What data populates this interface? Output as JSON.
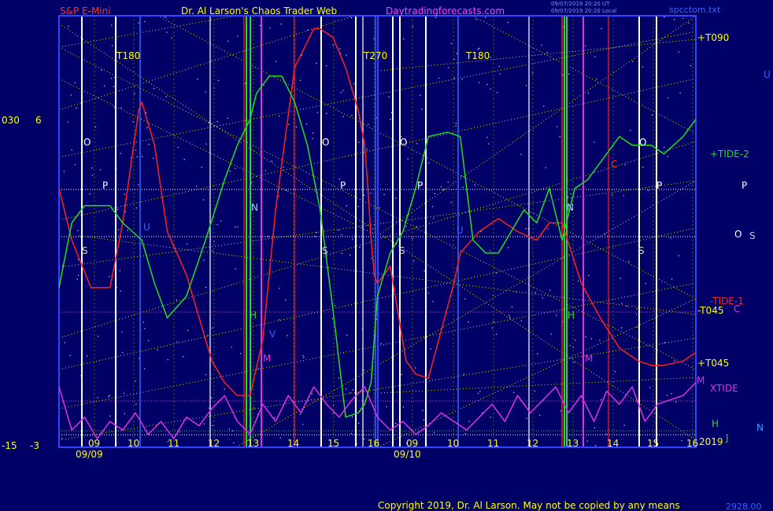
{
  "header": {
    "symbol": "S&P E-Mini",
    "title": "Dr. Al Larson's Chaos Trader Web",
    "site": "Daytradingforecasts.com",
    "stamp1": "09/07/2019 20:20 UT",
    "stamp2": "09/07/2019 20:20 Local",
    "file": "spcctom.txt"
  },
  "left_scale": {
    "top_a": "030",
    "top_b": "6",
    "bottom_a": "-15",
    "bottom_b": "-3"
  },
  "footer": {
    "copyright": "Copyright 2019, Dr. Al Larson. May not be copied by any means",
    "price": "2928.00"
  },
  "colors": {
    "bg": "#000066",
    "frame": "#3344ff",
    "red": "#ff2020",
    "green": "#20e020",
    "magenta": "#e030e0",
    "yellow": "#e8e800",
    "white": "#ffffff",
    "blue": "#3366ff"
  },
  "chart_data": {
    "type": "line",
    "x_ticks": [
      "09",
      "10",
      "11",
      "12",
      "13",
      "14",
      "15",
      "16",
      "09",
      "10",
      "11",
      "12",
      "13",
      "14",
      "15",
      "16"
    ],
    "dates": [
      "09/09",
      "09/10"
    ],
    "series": [
      {
        "name": "-TIDE-1",
        "color": "#ff2020",
        "x": [
          0,
          0.02,
          0.05,
          0.08,
          0.1,
          0.125,
          0.13,
          0.15,
          0.17,
          0.2,
          0.22,
          0.24,
          0.26,
          0.28,
          0.3,
          0.32,
          0.34,
          0.37,
          0.4,
          0.41,
          0.43,
          0.45,
          0.47,
          0.48,
          0.485,
          0.49,
          0.495,
          0.5,
          0.52,
          0.545,
          0.56,
          0.58,
          0.6,
          0.62,
          0.63,
          0.66,
          0.69,
          0.72,
          0.75,
          0.77,
          0.79,
          0.82,
          0.85,
          0.88,
          0.91,
          0.93,
          0.95,
          0.98,
          1.0
        ],
        "y": [
          0.6,
          0.48,
          0.37,
          0.37,
          0.52,
          0.78,
          0.8,
          0.7,
          0.5,
          0.4,
          0.3,
          0.2,
          0.15,
          0.12,
          0.12,
          0.25,
          0.55,
          0.88,
          0.97,
          0.97,
          0.95,
          0.88,
          0.78,
          0.7,
          0.6,
          0.48,
          0.4,
          0.38,
          0.42,
          0.2,
          0.17,
          0.16,
          0.27,
          0.38,
          0.45,
          0.5,
          0.53,
          0.5,
          0.48,
          0.52,
          0.52,
          0.38,
          0.3,
          0.23,
          0.2,
          0.19,
          0.19,
          0.2,
          0.22
        ]
      },
      {
        "name": "+TIDE-2",
        "color": "#20e020",
        "x": [
          0,
          0.02,
          0.04,
          0.06,
          0.08,
          0.1,
          0.13,
          0.15,
          0.17,
          0.2,
          0.23,
          0.26,
          0.28,
          0.3,
          0.31,
          0.33,
          0.35,
          0.37,
          0.39,
          0.41,
          0.43,
          0.45,
          0.47,
          0.48,
          0.49,
          0.5,
          0.52,
          0.54,
          0.56,
          0.58,
          0.61,
          0.63,
          0.65,
          0.67,
          0.69,
          0.71,
          0.73,
          0.75,
          0.77,
          0.79,
          0.81,
          0.83,
          0.86,
          0.88,
          0.9,
          0.93,
          0.95,
          0.98,
          1.0
        ],
        "y": [
          0.37,
          0.52,
          0.56,
          0.56,
          0.56,
          0.52,
          0.48,
          0.38,
          0.3,
          0.35,
          0.48,
          0.62,
          0.7,
          0.76,
          0.82,
          0.86,
          0.86,
          0.8,
          0.7,
          0.55,
          0.32,
          0.07,
          0.08,
          0.1,
          0.15,
          0.35,
          0.45,
          0.5,
          0.6,
          0.72,
          0.73,
          0.72,
          0.48,
          0.45,
          0.45,
          0.5,
          0.55,
          0.52,
          0.6,
          0.48,
          0.6,
          0.62,
          0.68,
          0.72,
          0.7,
          0.7,
          0.68,
          0.72,
          0.76
        ]
      },
      {
        "name": "XTIDE",
        "color": "#e030e0",
        "x": [
          0,
          0.02,
          0.04,
          0.06,
          0.08,
          0.1,
          0.12,
          0.14,
          0.16,
          0.18,
          0.2,
          0.22,
          0.24,
          0.26,
          0.28,
          0.3,
          0.32,
          0.34,
          0.36,
          0.38,
          0.4,
          0.42,
          0.44,
          0.46,
          0.48,
          0.5,
          0.52,
          0.54,
          0.56,
          0.58,
          0.6,
          0.62,
          0.64,
          0.66,
          0.68,
          0.7,
          0.72,
          0.74,
          0.76,
          0.78,
          0.8,
          0.82,
          0.84,
          0.86,
          0.88,
          0.9,
          0.92,
          0.94,
          0.96,
          0.98,
          1.0
        ],
        "y": [
          0.14,
          0.04,
          0.07,
          0.02,
          0.06,
          0.04,
          0.08,
          0.03,
          0.06,
          0.02,
          0.07,
          0.05,
          0.09,
          0.12,
          0.06,
          0.03,
          0.1,
          0.06,
          0.12,
          0.08,
          0.14,
          0.1,
          0.07,
          0.11,
          0.14,
          0.07,
          0.04,
          0.06,
          0.03,
          0.05,
          0.08,
          0.06,
          0.04,
          0.07,
          0.1,
          0.06,
          0.12,
          0.08,
          0.11,
          0.14,
          0.08,
          0.12,
          0.06,
          0.13,
          0.1,
          0.14,
          0.06,
          0.1,
          0.11,
          0.12,
          0.15
        ]
      }
    ]
  },
  "grid_lines": [
    {
      "label": "T180"
    },
    {
      "label": "T270"
    },
    {
      "label": "T180"
    }
  ],
  "letters": {
    "o": "O",
    "p": "P",
    "s": "S",
    "n": "N",
    "h": "H",
    "m": "M",
    "c": "C",
    "v": "V",
    "u": "U",
    "j": "J"
  },
  "right_labels": {
    "t090": "+T090",
    "tide2": "+TIDE-2",
    "p": "P",
    "o": "O",
    "s": "S",
    "tide1": "-TIDE-1",
    "t045m": "-T045",
    "c": "C",
    "t045p": "+T045",
    "m": "M",
    "xtide": "XTIDE",
    "h": "H",
    "n": "N",
    "year": "2019",
    "u": "U",
    "j": "J"
  }
}
